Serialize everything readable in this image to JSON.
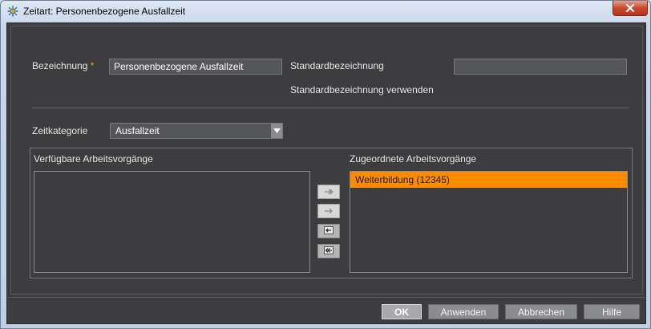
{
  "window": {
    "title": "Zeitart: Personenbezogene Ausfallzeit",
    "icon": "gear-sun-icon",
    "accent_color": "#ff8c00"
  },
  "form": {
    "bezeichnung_label": "Bezeichnung",
    "required_marker": "*",
    "bezeichnung_value": "Personenbezogene Ausfallzeit",
    "standard_label": "Standardbezeichnung",
    "standard_value": "",
    "standard_use_label": "Standardbezeichnung verwenden",
    "zeitkategorie_label": "Zeitkategorie",
    "zeitkategorie_value": "Ausfallzeit"
  },
  "assign": {
    "available_label": "Verfügbare Arbeitsvorgänge",
    "assigned_label": "Zugeordnete Arbeitsvorgänge",
    "available_items": [],
    "assigned_items": [
      "Weiterbildung (12345)"
    ],
    "move_buttons": [
      "move-all-right-icon",
      "move-right-icon",
      "move-left-icon",
      "move-all-left-icon"
    ]
  },
  "buttons": {
    "ok": "OK",
    "apply": "Anwenden",
    "cancel": "Abbrechen",
    "help": "Hilfe"
  }
}
